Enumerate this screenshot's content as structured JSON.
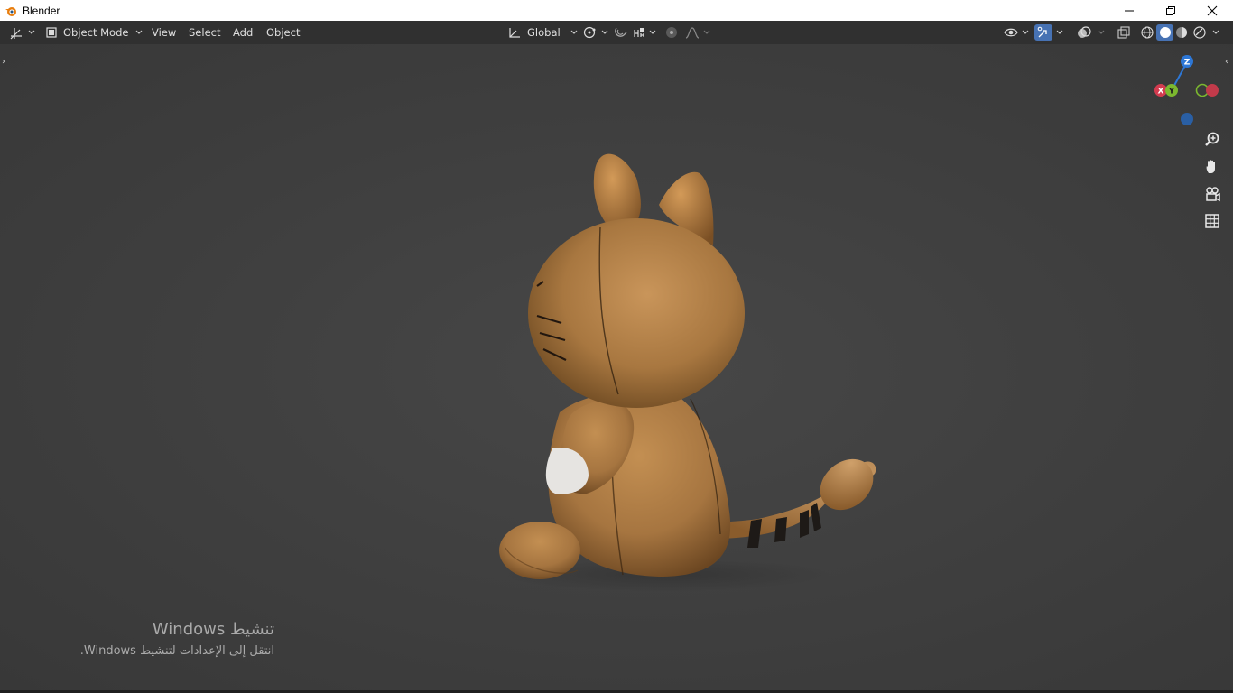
{
  "window": {
    "title": "Blender",
    "app_icon": "blender-logo-icon",
    "controls": [
      "minimize-icon",
      "restore-icon",
      "close-icon"
    ]
  },
  "header": {
    "editor_type_icon": "3d-viewport-editor-icon",
    "mode": {
      "label": "Object Mode",
      "icon": "object-mode-icon"
    },
    "menus": [
      "View",
      "Select",
      "Add",
      "Object"
    ],
    "transform_orientation": {
      "label": "Global",
      "icon": "transform-orientation-icon"
    },
    "pivot_icon": "pivot-point-icon",
    "snap_icon": "snap-magnet-icon",
    "snap_target_icon": "snap-increment-icon",
    "proportional_icon": "proportional-editing-icon",
    "falloff_icon": "falloff-curve-icon",
    "visibility_icon": "object-visibility-icon",
    "gizmo_icon": "gizmo-toggle-icon",
    "overlay_icon": "overlays-icon",
    "xray_icon": "xray-toggle-icon",
    "shading": [
      "wireframe-shading-icon",
      "solid-shading-icon",
      "material-preview-icon",
      "rendered-shading-icon"
    ],
    "active_shading": "solid-shading-icon"
  },
  "viewport": {
    "background_color": "#3d3d3d",
    "gizmo_axes": {
      "x": "X",
      "y": "Y",
      "z": "Z"
    },
    "axis_colors": {
      "x": "#d33b4f",
      "y": "#7cb82f",
      "z": "#2d77d6"
    },
    "nav_tools": [
      "zoom-icon",
      "pan-hand-icon",
      "camera-view-icon",
      "ortho-grid-icon"
    ],
    "subject": "tabby-cat-figurine"
  },
  "activation_watermark": {
    "title": "تنشيط Windows",
    "subtitle": "انتقل إلى الإعدادات لتنشيط Windows."
  }
}
